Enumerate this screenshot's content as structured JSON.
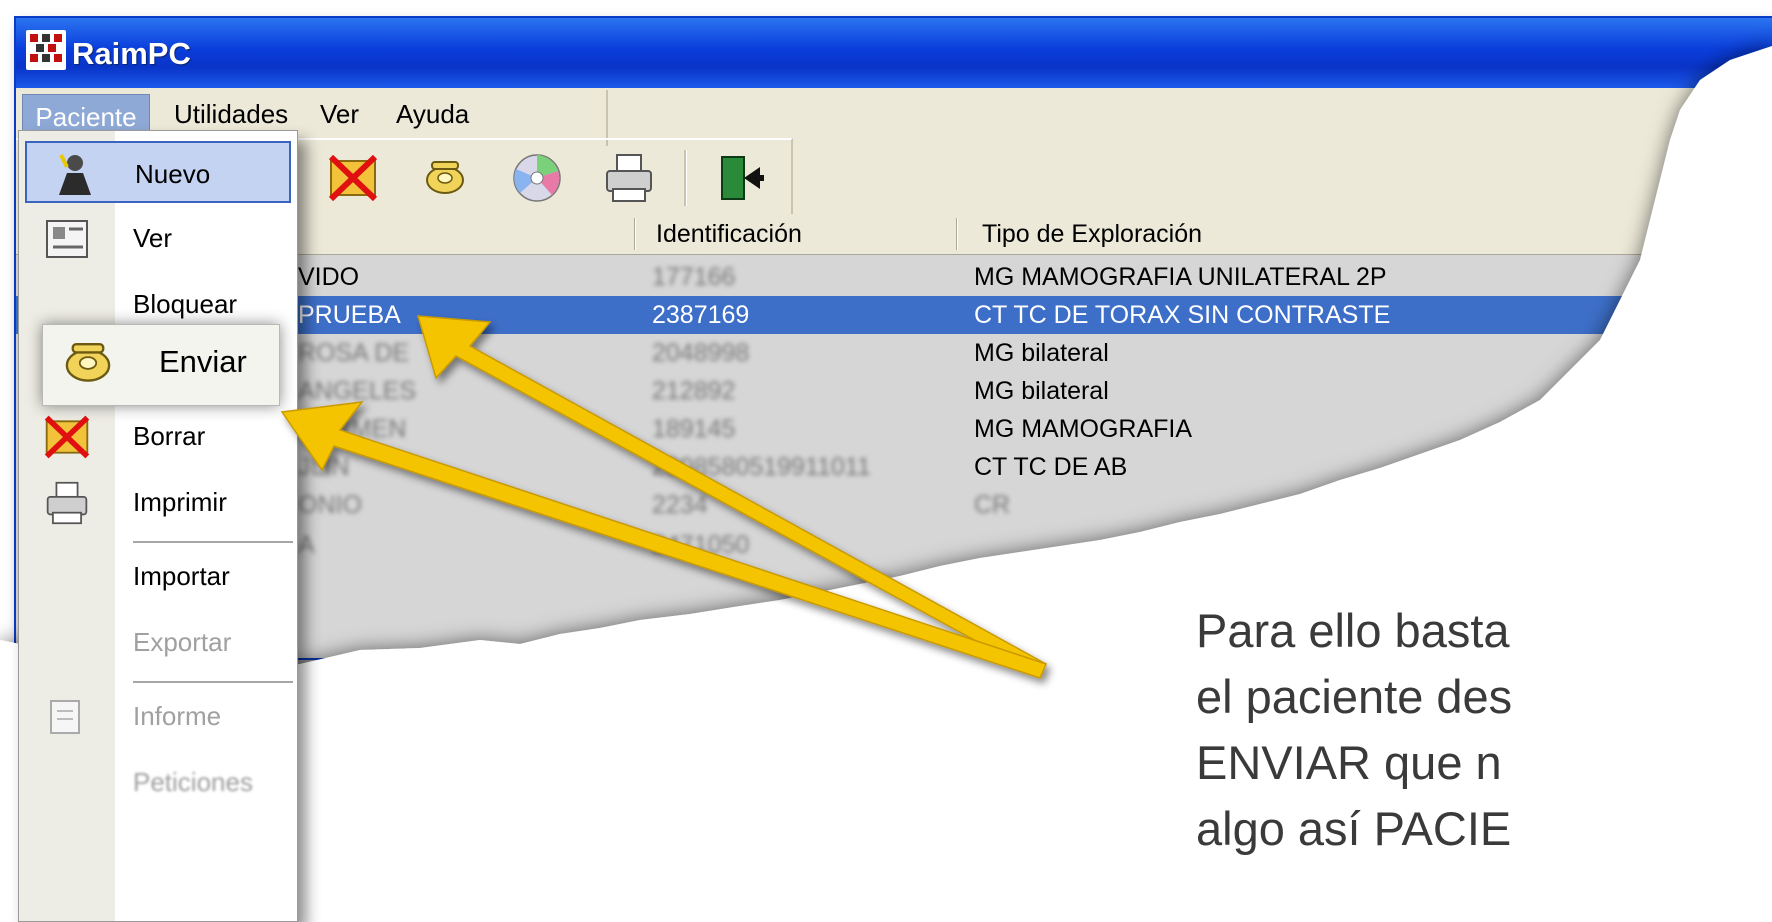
{
  "window": {
    "title": "RaimPC"
  },
  "menubar": {
    "items": [
      "Paciente",
      "Utilidades",
      "Ver",
      "Ayuda"
    ]
  },
  "toolbar": {
    "buttons": [
      "delete-icon",
      "phone-send-icon",
      "cd-icon",
      "printer-icon",
      "exit-door-icon"
    ]
  },
  "table": {
    "columns": [
      "Identificación",
      "Tipo de Exploración"
    ],
    "rows": [
      {
        "name": "VIDO",
        "id": "177166",
        "exam": "MG MAMOGRAFIA UNILATERAL  2P"
      },
      {
        "name": "PRUEBA",
        "id": "2387169",
        "exam": "CT TC DE TORAX SIN CONTRASTE",
        "selected": true
      },
      {
        "name": "ROSA DE",
        "id": "2048998",
        "exam": "MG bilateral"
      },
      {
        "name": "ANGELES",
        "id": "212892",
        "exam": "MG bilateral"
      },
      {
        "name": "CARMEN",
        "id": "189145",
        "exam": "MG MAMOGRAFIA"
      },
      {
        "name": "JLIN",
        "id": "2008580519911011",
        "exam": "CT TC DE AB"
      },
      {
        "name": "ONIO",
        "id": "2234",
        "exam": "CR"
      },
      {
        "name": "A",
        "id": "2471050",
        "exam": ""
      }
    ]
  },
  "dropdown": {
    "items": [
      {
        "label": "Nuevo",
        "mnemonic": "N",
        "icon": "new-patient-icon"
      },
      {
        "label": "Ver",
        "mnemonic": "V",
        "icon": "view-icon"
      },
      {
        "label": "Bloquear",
        "mnemonic": "o",
        "icon": ""
      },
      {
        "label": "Enviar",
        "mnemonic": "v",
        "icon": "phone-send-icon"
      },
      {
        "label": "Borrar",
        "mnemonic": "B",
        "icon": "delete-icon"
      },
      {
        "label": "Imprimir",
        "mnemonic": "I",
        "icon": "printer-icon"
      },
      {
        "label": "Importar",
        "mnemonic": "I",
        "icon": ""
      },
      {
        "label": "Exportar",
        "mnemonic": "E",
        "icon": "",
        "disabled": true
      },
      {
        "label": "Informe",
        "mnemonic": "I",
        "icon": "report-icon",
        "disabled": true
      },
      {
        "label": "Peticiones",
        "mnemonic": "P",
        "icon": "",
        "disabled": true
      }
    ]
  },
  "callout": {
    "label": "Enviar",
    "text_lines": [
      "Para ello basta",
      "el paciente des",
      "ENVIAR que n",
      "algo así PACIE"
    ]
  },
  "colors": {
    "titlebar": "#0A3DDB",
    "selection": "#3D6FC8",
    "arrow": "#F5C400"
  }
}
